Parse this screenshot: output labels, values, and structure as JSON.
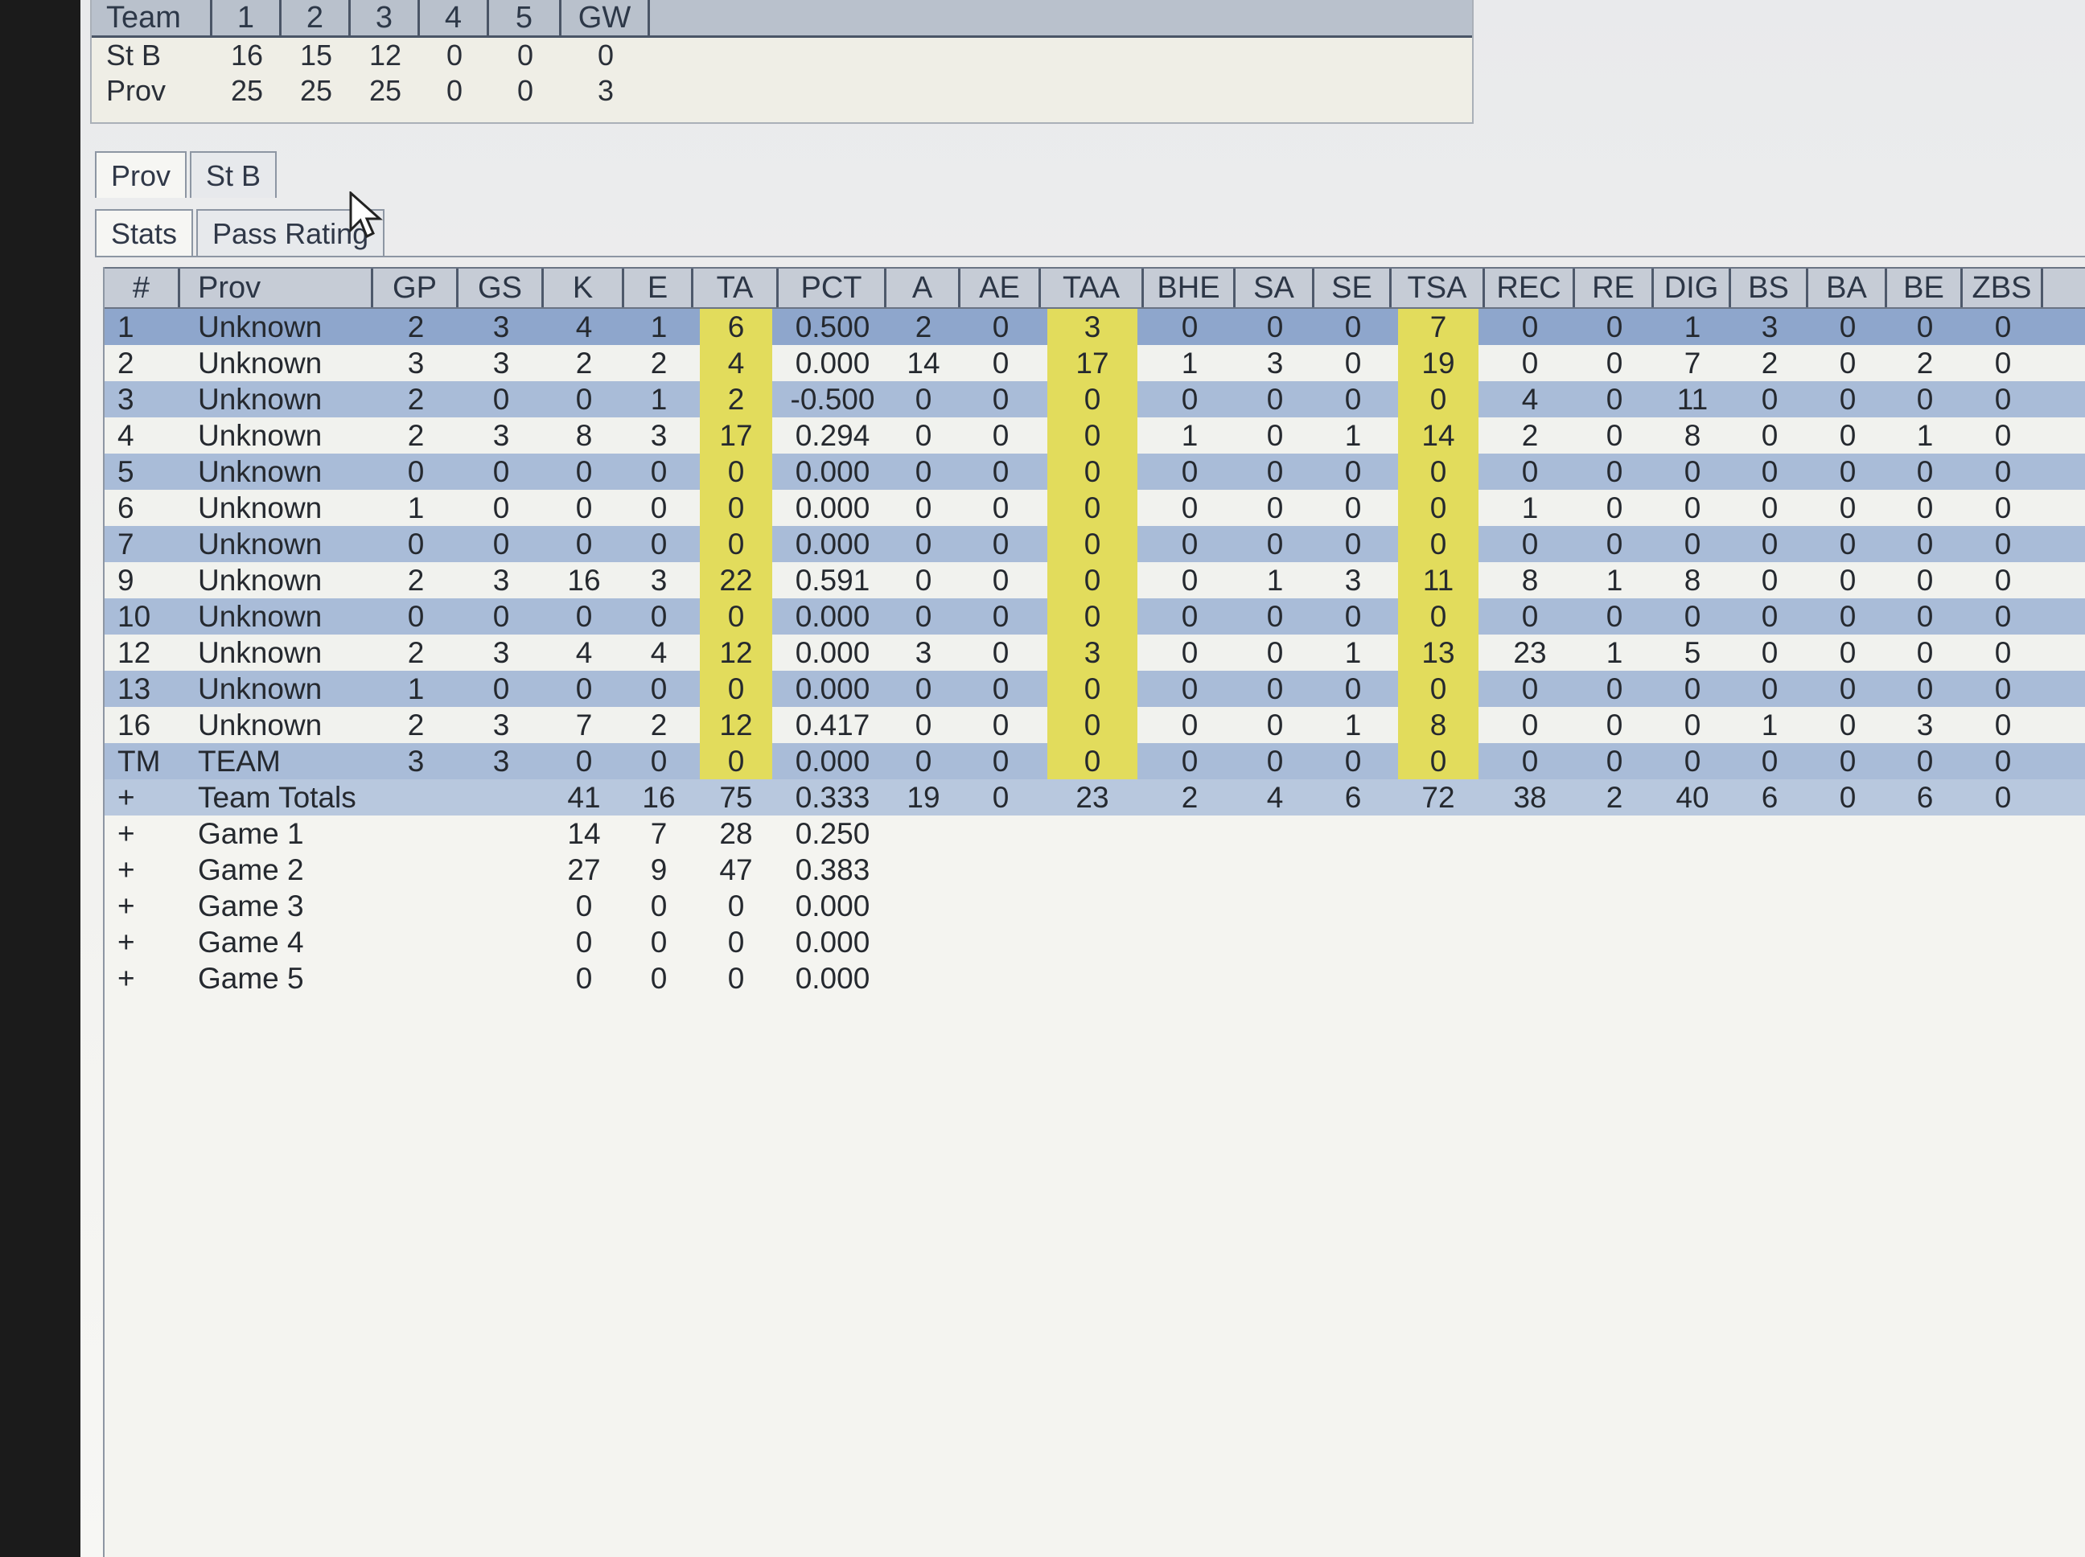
{
  "score": {
    "headers": [
      "Team",
      "1",
      "2",
      "3",
      "4",
      "5",
      "GW"
    ],
    "rows": [
      [
        "St B",
        "16",
        "15",
        "12",
        "0",
        "0",
        "0"
      ],
      [
        "Prov",
        "25",
        "25",
        "25",
        "0",
        "0",
        "3"
      ]
    ]
  },
  "team_tabs": [
    {
      "label": "Prov",
      "active": true
    },
    {
      "label": "St B",
      "active": false
    }
  ],
  "view_tabs": [
    {
      "label": "Stats",
      "active": true
    },
    {
      "label": "Pass Rating",
      "active": false
    }
  ],
  "grid": {
    "columns": [
      "#",
      "Prov",
      "GP",
      "GS",
      "K",
      "E",
      "TA",
      "PCT",
      "A",
      "AE",
      "TAA",
      "BHE",
      "SA",
      "SE",
      "TSA",
      "REC",
      "RE",
      "DIG",
      "BS",
      "BA",
      "BE",
      "ZBS"
    ],
    "highlight_columns": [
      "TA",
      "TAA",
      "TSA"
    ],
    "highlight_color": "#e2dc5c",
    "player_rows": [
      [
        "1",
        "Unknown",
        "2",
        "3",
        "4",
        "1",
        "6",
        "0.500",
        "2",
        "0",
        "3",
        "0",
        "0",
        "0",
        "7",
        "0",
        "0",
        "1",
        "3",
        "0",
        "0",
        "0"
      ],
      [
        "2",
        "Unknown",
        "3",
        "3",
        "2",
        "2",
        "4",
        "0.000",
        "14",
        "0",
        "17",
        "1",
        "3",
        "0",
        "19",
        "0",
        "0",
        "7",
        "2",
        "0",
        "2",
        "0"
      ],
      [
        "3",
        "Unknown",
        "2",
        "0",
        "0",
        "1",
        "2",
        "-0.500",
        "0",
        "0",
        "0",
        "0",
        "0",
        "0",
        "0",
        "4",
        "0",
        "11",
        "0",
        "0",
        "0",
        "0"
      ],
      [
        "4",
        "Unknown",
        "2",
        "3",
        "8",
        "3",
        "17",
        "0.294",
        "0",
        "0",
        "0",
        "1",
        "0",
        "1",
        "14",
        "2",
        "0",
        "8",
        "0",
        "0",
        "1",
        "0"
      ],
      [
        "5",
        "Unknown",
        "0",
        "0",
        "0",
        "0",
        "0",
        "0.000",
        "0",
        "0",
        "0",
        "0",
        "0",
        "0",
        "0",
        "0",
        "0",
        "0",
        "0",
        "0",
        "0",
        "0"
      ],
      [
        "6",
        "Unknown",
        "1",
        "0",
        "0",
        "0",
        "0",
        "0.000",
        "0",
        "0",
        "0",
        "0",
        "0",
        "0",
        "0",
        "1",
        "0",
        "0",
        "0",
        "0",
        "0",
        "0"
      ],
      [
        "7",
        "Unknown",
        "0",
        "0",
        "0",
        "0",
        "0",
        "0.000",
        "0",
        "0",
        "0",
        "0",
        "0",
        "0",
        "0",
        "0",
        "0",
        "0",
        "0",
        "0",
        "0",
        "0"
      ],
      [
        "9",
        "Unknown",
        "2",
        "3",
        "16",
        "3",
        "22",
        "0.591",
        "0",
        "0",
        "0",
        "0",
        "1",
        "3",
        "11",
        "8",
        "1",
        "8",
        "0",
        "0",
        "0",
        "0"
      ],
      [
        "10",
        "Unknown",
        "0",
        "0",
        "0",
        "0",
        "0",
        "0.000",
        "0",
        "0",
        "0",
        "0",
        "0",
        "0",
        "0",
        "0",
        "0",
        "0",
        "0",
        "0",
        "0",
        "0"
      ],
      [
        "12",
        "Unknown",
        "2",
        "3",
        "4",
        "4",
        "12",
        "0.000",
        "3",
        "0",
        "3",
        "0",
        "0",
        "1",
        "13",
        "23",
        "1",
        "5",
        "0",
        "0",
        "0",
        "0"
      ],
      [
        "13",
        "Unknown",
        "1",
        "0",
        "0",
        "0",
        "0",
        "0.000",
        "0",
        "0",
        "0",
        "0",
        "0",
        "0",
        "0",
        "0",
        "0",
        "0",
        "0",
        "0",
        "0",
        "0"
      ],
      [
        "16",
        "Unknown",
        "2",
        "3",
        "7",
        "2",
        "12",
        "0.417",
        "0",
        "0",
        "0",
        "0",
        "0",
        "1",
        "8",
        "0",
        "0",
        "0",
        "1",
        "0",
        "3",
        "0"
      ],
      [
        "TM",
        "TEAM",
        "3",
        "3",
        "0",
        "0",
        "0",
        "0.000",
        "0",
        "0",
        "0",
        "0",
        "0",
        "0",
        "0",
        "0",
        "0",
        "0",
        "0",
        "0",
        "0",
        "0"
      ]
    ],
    "total_rows": [
      [
        "+",
        "Team Totals",
        "",
        "",
        "41",
        "16",
        "75",
        "0.333",
        "19",
        "0",
        "23",
        "2",
        "4",
        "6",
        "72",
        "38",
        "2",
        "40",
        "6",
        "0",
        "6",
        "0"
      ],
      [
        "+",
        "Game 1",
        "",
        "",
        "14",
        "7",
        "28",
        "0.250",
        "",
        "",
        "",
        "",
        "",
        "",
        "",
        "",
        "",
        "",
        "",
        "",
        "",
        ""
      ],
      [
        "+",
        "Game 2",
        "",
        "",
        "27",
        "9",
        "47",
        "0.383",
        "",
        "",
        "",
        "",
        "",
        "",
        "",
        "",
        "",
        "",
        "",
        "",
        "",
        ""
      ],
      [
        "+",
        "Game 3",
        "",
        "",
        "0",
        "0",
        "0",
        "0.000",
        "",
        "",
        "",
        "",
        "",
        "",
        "",
        "",
        "",
        "",
        "",
        "",
        "",
        ""
      ],
      [
        "+",
        "Game 4",
        "",
        "",
        "0",
        "0",
        "0",
        "0.000",
        "",
        "",
        "",
        "",
        "",
        "",
        "",
        "",
        "",
        "",
        "",
        "",
        "",
        ""
      ],
      [
        "+",
        "Game 5",
        "",
        "",
        "0",
        "0",
        "0",
        "0.000",
        "",
        "",
        "",
        "",
        "",
        "",
        "",
        "",
        "",
        "",
        "",
        "",
        "",
        ""
      ]
    ]
  }
}
